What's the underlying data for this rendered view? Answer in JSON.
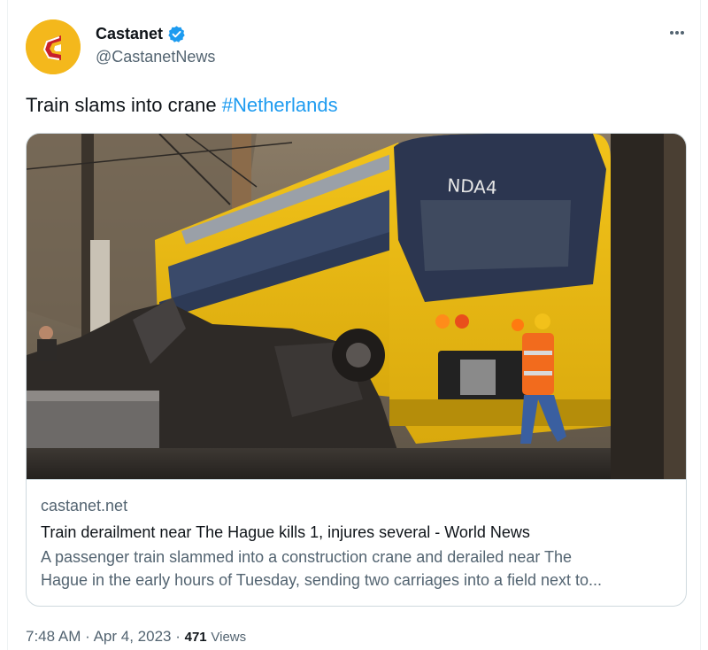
{
  "author": {
    "name": "Castanet",
    "handle": "@CastanetNews",
    "verified": true
  },
  "tweet": {
    "text": "Train slams into crane ",
    "hashtag": "#Netherlands"
  },
  "card": {
    "domain": "castanet.net",
    "title": "Train derailment near The Hague kills 1, injures several - World News",
    "description_line1": "A passenger train slammed into a construction crane and derailed near The",
    "description_line2": "Hague in the early hours of Tuesday, sending two carriages into a field next to..."
  },
  "meta": {
    "time": "7:48 AM",
    "separator": "·",
    "date": "Apr 4, 2023",
    "views_count": "471",
    "views_label": "Views"
  },
  "colors": {
    "link": "#1d9bf0",
    "text": "#0f1419",
    "secondary": "#536471",
    "avatar_bg": "#f4b81c",
    "logo_red": "#c8202a"
  },
  "icons": {
    "verified": "verified-badge-icon",
    "more": "more-options-icon"
  }
}
